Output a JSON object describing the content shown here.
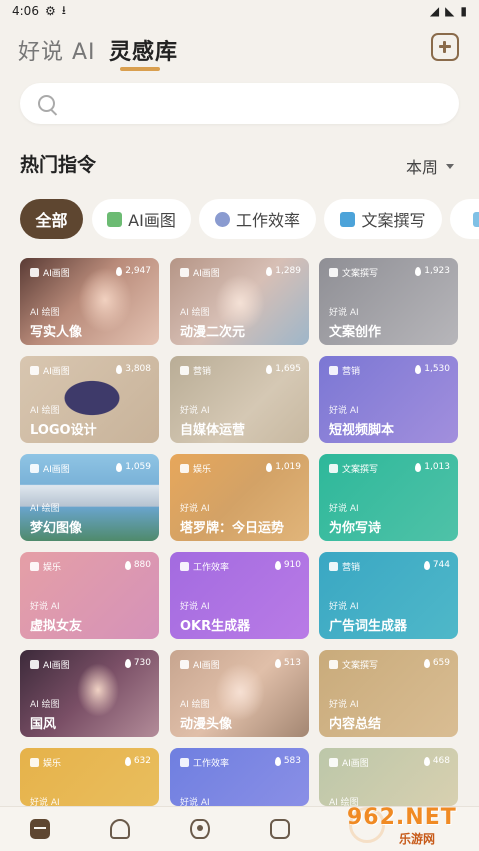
{
  "status_bar": {
    "time": "4:06"
  },
  "header": {
    "tabs": [
      {
        "label": "好说 AI"
      },
      {
        "label": "灵感库"
      }
    ]
  },
  "search": {
    "placeholder": ""
  },
  "section": {
    "title": "热门指令",
    "period": "本周"
  },
  "chips": [
    {
      "label": "全部"
    },
    {
      "label": "AI画图"
    },
    {
      "label": "工作效率"
    },
    {
      "label": "文案撰写"
    }
  ],
  "cards": [
    {
      "tag": "AI画图",
      "count": "2,947",
      "sub": "AI 绘图",
      "title": "写实人像"
    },
    {
      "tag": "AI画图",
      "count": "1,289",
      "sub": "AI 绘图",
      "title": "动漫二次元"
    },
    {
      "tag": "文案撰写",
      "count": "1,923",
      "sub": "好说 AI",
      "title": "文案创作"
    },
    {
      "tag": "AI画图",
      "count": "3,808",
      "sub": "AI 绘图",
      "title": "LOGO设计"
    },
    {
      "tag": "营销",
      "count": "1,695",
      "sub": "好说 AI",
      "title": "自媒体运营"
    },
    {
      "tag": "营销",
      "count": "1,530",
      "sub": "好说 AI",
      "title": "短视频脚本"
    },
    {
      "tag": "AI画图",
      "count": "1,059",
      "sub": "AI 绘图",
      "title": "梦幻图像"
    },
    {
      "tag": "娱乐",
      "count": "1,019",
      "sub": "好说 AI",
      "title": "塔罗牌：今日运势"
    },
    {
      "tag": "文案撰写",
      "count": "1,013",
      "sub": "好说 AI",
      "title": "为你写诗"
    },
    {
      "tag": "娱乐",
      "count": "880",
      "sub": "好说 AI",
      "title": "虚拟女友"
    },
    {
      "tag": "工作效率",
      "count": "910",
      "sub": "好说 AI",
      "title": "OKR生成器"
    },
    {
      "tag": "营销",
      "count": "744",
      "sub": "好说 AI",
      "title": "广告词生成器"
    },
    {
      "tag": "AI画图",
      "count": "730",
      "sub": "AI 绘图",
      "title": "国风"
    },
    {
      "tag": "AI画图",
      "count": "513",
      "sub": "AI 绘图",
      "title": "动漫头像"
    },
    {
      "tag": "文案撰写",
      "count": "659",
      "sub": "好说 AI",
      "title": "内容总结"
    },
    {
      "tag": "娱乐",
      "count": "632",
      "sub": "好说 AI",
      "title": ""
    },
    {
      "tag": "工作效率",
      "count": "583",
      "sub": "好说 AI",
      "title": ""
    },
    {
      "tag": "AI画图",
      "count": "468",
      "sub": "AI 绘图",
      "title": ""
    }
  ],
  "watermark": {
    "top": "962.NET",
    "bottom": "乐游网"
  },
  "colors": {
    "accent": "#d99f4f",
    "active_chip": "#5e4630"
  }
}
